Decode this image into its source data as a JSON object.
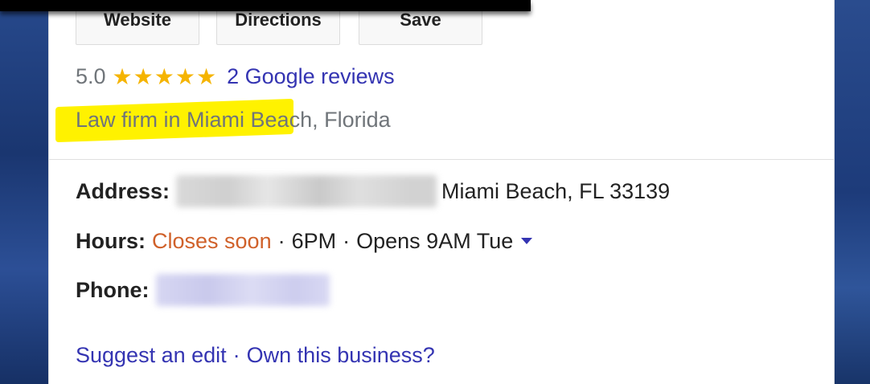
{
  "actions": {
    "website_label": "Website",
    "directions_label": "Directions",
    "save_label": "Save"
  },
  "rating": {
    "score": "5.0",
    "stars": "★★★★★",
    "reviews_link": "2 Google reviews"
  },
  "category": {
    "text": "Law firm in Miami Beach, Florida"
  },
  "address": {
    "label": "Address:",
    "visible_part": "Miami Beach, FL 33139"
  },
  "hours": {
    "label": "Hours:",
    "status": "Closes soon",
    "separator": "·",
    "close_time": "6PM",
    "opens": "Opens 9AM Tue"
  },
  "phone": {
    "label": "Phone:"
  },
  "footer": {
    "suggest_edit": "Suggest an edit",
    "separator": "·",
    "own_business": "Own this business?"
  },
  "colors": {
    "link": "#3434b2",
    "star": "#f5b400",
    "closes_soon": "#d0612a",
    "highlight": "#fff200"
  }
}
